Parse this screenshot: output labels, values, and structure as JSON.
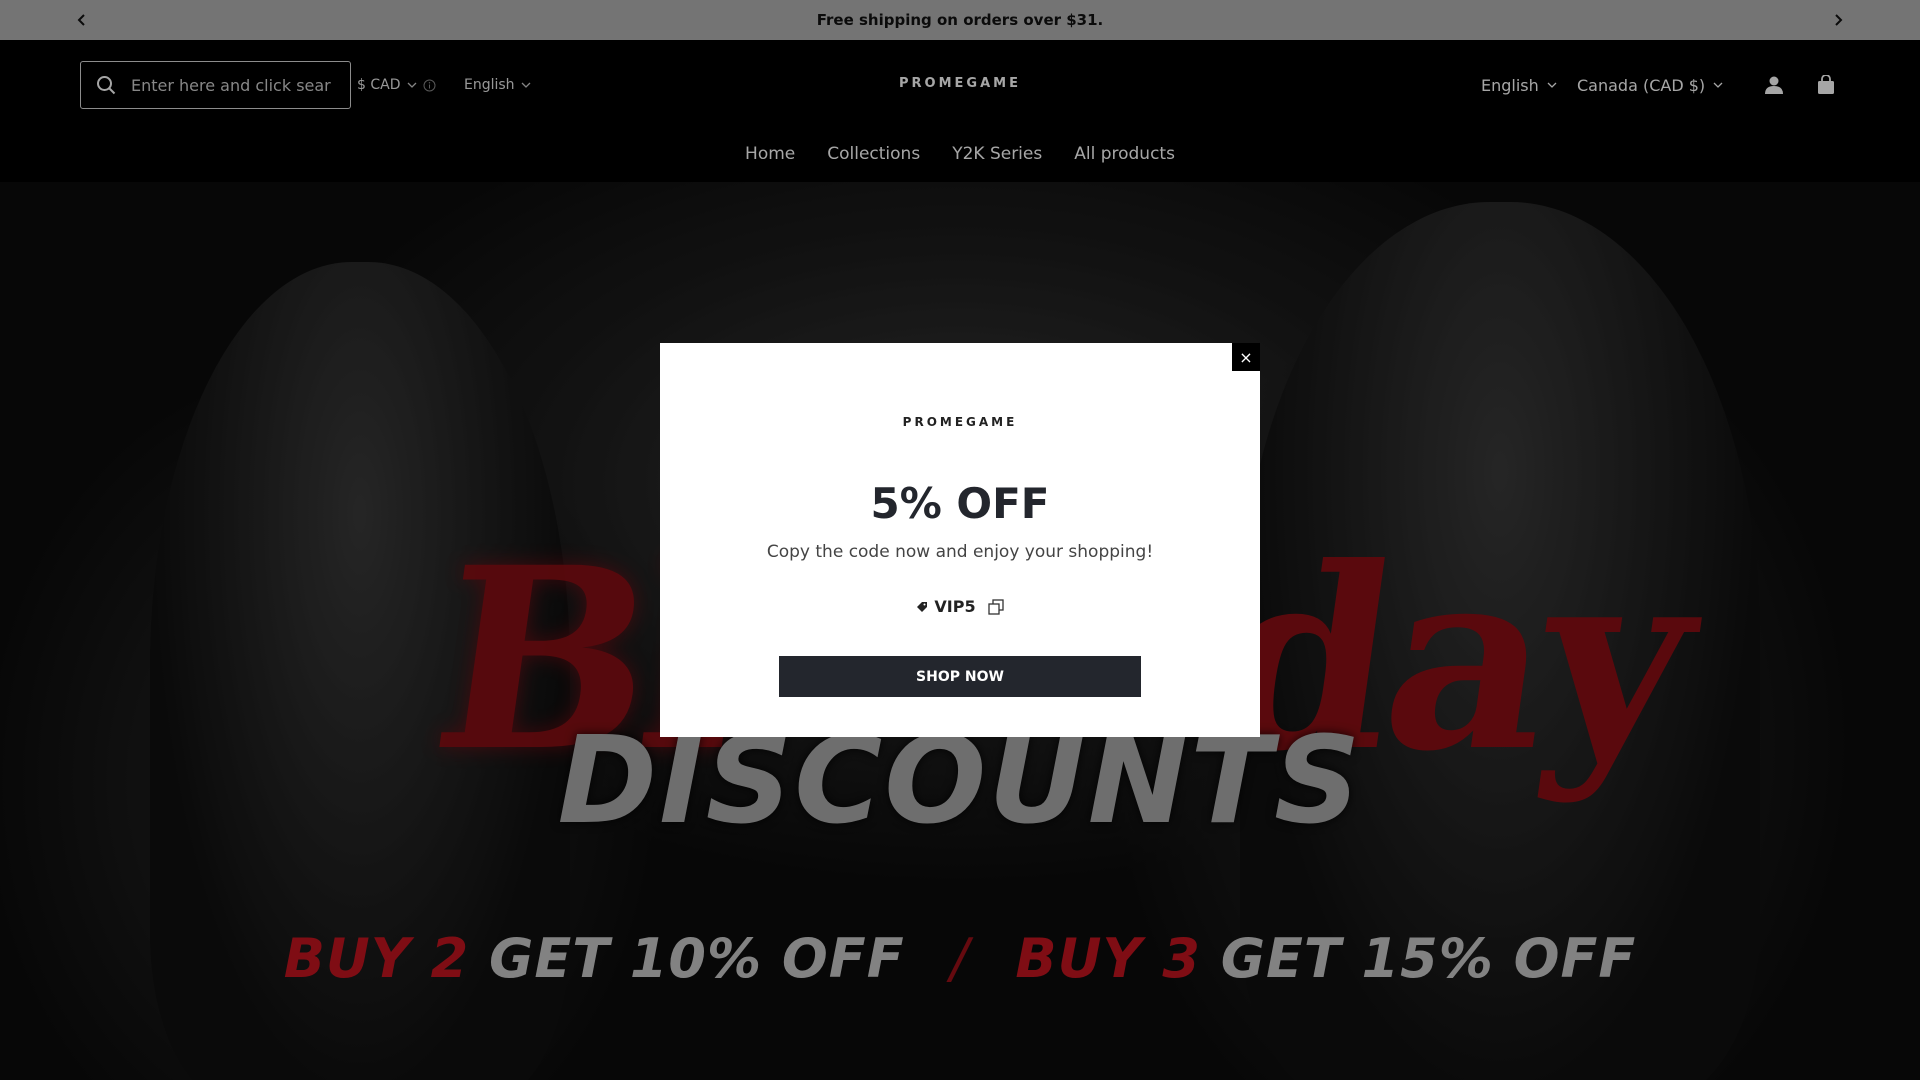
{
  "announcement": {
    "message": "Free shipping on orders over $31.",
    "prev_icon": "chevron-left-icon",
    "next_icon": "chevron-right-icon"
  },
  "header": {
    "search": {
      "placeholder": "Enter here and click search",
      "value": ""
    },
    "currency": {
      "label": "$ CAD"
    },
    "language_left": {
      "label": "English"
    },
    "logo": "PROMEGAME",
    "language_right": {
      "label": "English"
    },
    "country": {
      "label": "Canada (CAD $)"
    }
  },
  "nav": {
    "items": [
      {
        "label": "Home"
      },
      {
        "label": "Collections"
      },
      {
        "label": "Y2K Series"
      },
      {
        "label": "All products"
      }
    ]
  },
  "hero": {
    "headline_fragment_left": "Bl",
    "headline_fragment_right": "day",
    "subheadline": "DISCOUNTS",
    "offer1_buy": "BUY 2",
    "offer1_get": "GET 10% OFF",
    "separator": "/",
    "offer2_buy": "BUY 3",
    "offer2_get": "GET 15% OFF"
  },
  "modal": {
    "logo": "PROMEGAME",
    "headline": "5% OFF",
    "subtext": "Copy the code now and enjoy your shopping!",
    "code": "VIP5",
    "cta": "SHOP NOW",
    "close_symbol": "×"
  },
  "colors": {
    "announcement_bg": "#b2b2b2",
    "header_bg": "#000000",
    "modal_button": "#23262d",
    "hero_red": "#c31420"
  }
}
